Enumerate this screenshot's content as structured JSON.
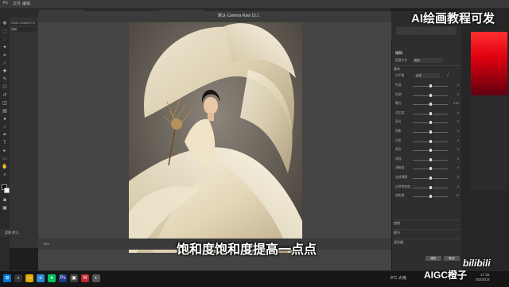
{
  "app": {
    "doc_tab_1": "00001-1166661774.png",
    "doc_tab_2": "图层 1",
    "camera_raw_title": "默认·Camera Raw 15.1"
  },
  "overlay": {
    "top_title": "AI绘画教程可发",
    "subtitle": "饱和度饱和度提高一点点",
    "brand": "AIGC橙子",
    "bili": "bilibili"
  },
  "history": {
    "items": [
      "00001-1166661774",
      "快照"
    ]
  },
  "layers_panel": {
    "label": "背景 拷贝..."
  },
  "cr_panel": {
    "title": "编辑",
    "profile_label": "配置文件",
    "profile_value": "颜色",
    "basic_section": "基本",
    "white_balance_label": "白平衡",
    "white_balance_value": "自定",
    "rows": [
      {
        "label": "色温",
        "value": "0",
        "level": 0.5
      },
      {
        "label": "色调",
        "value": "0",
        "level": 0.5
      },
      {
        "label": "曝光",
        "value": "0.00",
        "level": 0.5
      },
      {
        "label": "对比度",
        "value": "0",
        "level": 0.5
      },
      {
        "label": "高光",
        "value": "0",
        "level": 0.5
      },
      {
        "label": "阴影",
        "value": "0",
        "level": 0.5
      },
      {
        "label": "白色",
        "value": "0",
        "level": 0.5
      },
      {
        "label": "黑色",
        "value": "0",
        "level": 0.5
      },
      {
        "label": "纹理",
        "value": "0",
        "level": 0.5
      },
      {
        "label": "清晰度",
        "value": "0",
        "level": 0.5
      },
      {
        "label": "去除薄雾",
        "value": "0",
        "level": 0.5
      },
      {
        "label": "自然饱和度",
        "value": "0",
        "level": 0.5
      },
      {
        "label": "饱和度",
        "value": "+2",
        "level": 0.52
      }
    ],
    "sections": [
      "曲线",
      "细节",
      "混色器"
    ],
    "ok_button": "确定",
    "cancel_button": "取消"
  },
  "status_bar": {
    "zoom": "16%",
    "info": "文档: 3.60M/4.23M"
  },
  "taskbar": {
    "weather": "8°C 大雨",
    "time": "17:32",
    "date": "2024/1/2"
  },
  "colors": {
    "accent_red": "#e00010",
    "subtitle_color": "#ffffff"
  }
}
